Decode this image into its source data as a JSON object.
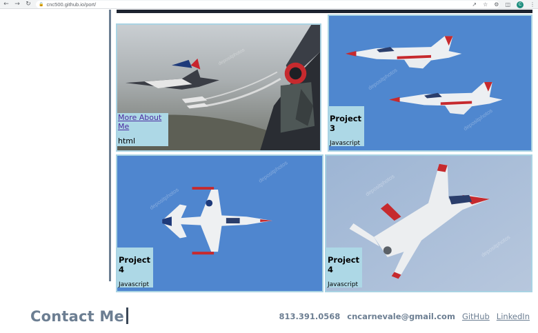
{
  "browser": {
    "url": "cnc500.github.io/port/",
    "back_icon": "arrow-left-icon",
    "forward_icon": "arrow-right-icon",
    "reload_icon": "reload-icon",
    "avatar_letter": "C"
  },
  "projects": [
    {
      "link": "More About Me",
      "lang": "html"
    },
    {
      "title": "Project 3",
      "lang": "Javascript"
    },
    {
      "title": "Project 4",
      "lang": "Javascript"
    },
    {
      "title": "Project 4",
      "lang": "Javascript"
    }
  ],
  "footer": {
    "heading": "Contact Me",
    "phone": "813.391.0568",
    "email": "cncarnevale@gmail.com",
    "github": "GitHub",
    "linkedin": "LinkedIn"
  },
  "watermark_text": "depositphotos",
  "colors": {
    "label_bg": "#add8e6",
    "card_border": "#a9d3e3",
    "accent": "#6c7e92",
    "sky_blue": "#5b8dd0"
  }
}
